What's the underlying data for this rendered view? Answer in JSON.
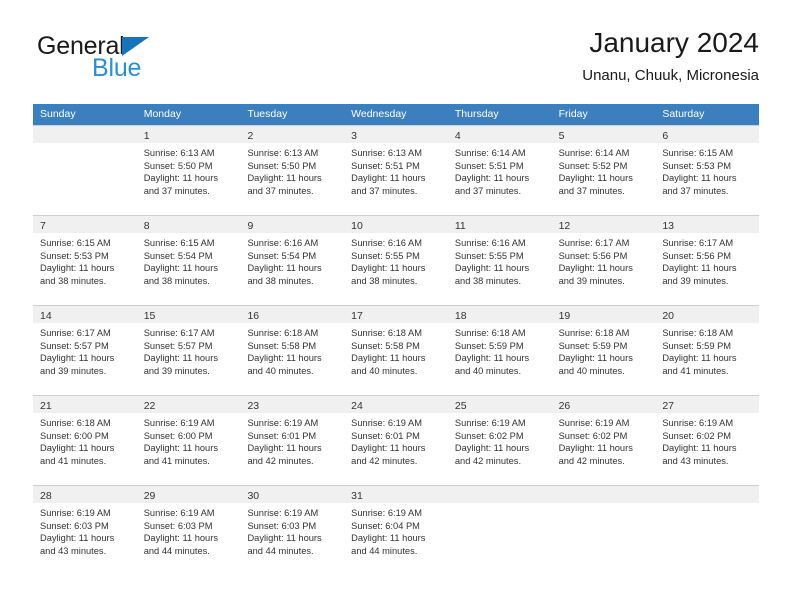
{
  "brand": {
    "name_part1": "General",
    "name_part2": "Blue",
    "triangle_color": "#1773ba",
    "blue_color": "#2b8fd4"
  },
  "header": {
    "title": "January 2024",
    "subtitle": "Unanu, Chuuk, Micronesia"
  },
  "theme": {
    "header_row_bg": "#3b7fbf",
    "header_row_text": "#ffffff",
    "daynum_band_bg": "#f0f0f0",
    "grid_line": "#cfcfcf",
    "body_text": "#333333"
  },
  "weekdays": [
    "Sunday",
    "Monday",
    "Tuesday",
    "Wednesday",
    "Thursday",
    "Friday",
    "Saturday"
  ],
  "weeks": [
    [
      {
        "day": "",
        "sunrise": "",
        "sunset": "",
        "daylight_line1": "",
        "daylight_line2": "",
        "empty": true
      },
      {
        "day": "1",
        "sunrise": "Sunrise: 6:13 AM",
        "sunset": "Sunset: 5:50 PM",
        "daylight_line1": "Daylight: 11 hours",
        "daylight_line2": "and 37 minutes."
      },
      {
        "day": "2",
        "sunrise": "Sunrise: 6:13 AM",
        "sunset": "Sunset: 5:50 PM",
        "daylight_line1": "Daylight: 11 hours",
        "daylight_line2": "and 37 minutes."
      },
      {
        "day": "3",
        "sunrise": "Sunrise: 6:13 AM",
        "sunset": "Sunset: 5:51 PM",
        "daylight_line1": "Daylight: 11 hours",
        "daylight_line2": "and 37 minutes."
      },
      {
        "day": "4",
        "sunrise": "Sunrise: 6:14 AM",
        "sunset": "Sunset: 5:51 PM",
        "daylight_line1": "Daylight: 11 hours",
        "daylight_line2": "and 37 minutes."
      },
      {
        "day": "5",
        "sunrise": "Sunrise: 6:14 AM",
        "sunset": "Sunset: 5:52 PM",
        "daylight_line1": "Daylight: 11 hours",
        "daylight_line2": "and 37 minutes."
      },
      {
        "day": "6",
        "sunrise": "Sunrise: 6:15 AM",
        "sunset": "Sunset: 5:53 PM",
        "daylight_line1": "Daylight: 11 hours",
        "daylight_line2": "and 37 minutes."
      }
    ],
    [
      {
        "day": "7",
        "sunrise": "Sunrise: 6:15 AM",
        "sunset": "Sunset: 5:53 PM",
        "daylight_line1": "Daylight: 11 hours",
        "daylight_line2": "and 38 minutes."
      },
      {
        "day": "8",
        "sunrise": "Sunrise: 6:15 AM",
        "sunset": "Sunset: 5:54 PM",
        "daylight_line1": "Daylight: 11 hours",
        "daylight_line2": "and 38 minutes."
      },
      {
        "day": "9",
        "sunrise": "Sunrise: 6:16 AM",
        "sunset": "Sunset: 5:54 PM",
        "daylight_line1": "Daylight: 11 hours",
        "daylight_line2": "and 38 minutes."
      },
      {
        "day": "10",
        "sunrise": "Sunrise: 6:16 AM",
        "sunset": "Sunset: 5:55 PM",
        "daylight_line1": "Daylight: 11 hours",
        "daylight_line2": "and 38 minutes."
      },
      {
        "day": "11",
        "sunrise": "Sunrise: 6:16 AM",
        "sunset": "Sunset: 5:55 PM",
        "daylight_line1": "Daylight: 11 hours",
        "daylight_line2": "and 38 minutes."
      },
      {
        "day": "12",
        "sunrise": "Sunrise: 6:17 AM",
        "sunset": "Sunset: 5:56 PM",
        "daylight_line1": "Daylight: 11 hours",
        "daylight_line2": "and 39 minutes."
      },
      {
        "day": "13",
        "sunrise": "Sunrise: 6:17 AM",
        "sunset": "Sunset: 5:56 PM",
        "daylight_line1": "Daylight: 11 hours",
        "daylight_line2": "and 39 minutes."
      }
    ],
    [
      {
        "day": "14",
        "sunrise": "Sunrise: 6:17 AM",
        "sunset": "Sunset: 5:57 PM",
        "daylight_line1": "Daylight: 11 hours",
        "daylight_line2": "and 39 minutes."
      },
      {
        "day": "15",
        "sunrise": "Sunrise: 6:17 AM",
        "sunset": "Sunset: 5:57 PM",
        "daylight_line1": "Daylight: 11 hours",
        "daylight_line2": "and 39 minutes."
      },
      {
        "day": "16",
        "sunrise": "Sunrise: 6:18 AM",
        "sunset": "Sunset: 5:58 PM",
        "daylight_line1": "Daylight: 11 hours",
        "daylight_line2": "and 40 minutes."
      },
      {
        "day": "17",
        "sunrise": "Sunrise: 6:18 AM",
        "sunset": "Sunset: 5:58 PM",
        "daylight_line1": "Daylight: 11 hours",
        "daylight_line2": "and 40 minutes."
      },
      {
        "day": "18",
        "sunrise": "Sunrise: 6:18 AM",
        "sunset": "Sunset: 5:59 PM",
        "daylight_line1": "Daylight: 11 hours",
        "daylight_line2": "and 40 minutes."
      },
      {
        "day": "19",
        "sunrise": "Sunrise: 6:18 AM",
        "sunset": "Sunset: 5:59 PM",
        "daylight_line1": "Daylight: 11 hours",
        "daylight_line2": "and 40 minutes."
      },
      {
        "day": "20",
        "sunrise": "Sunrise: 6:18 AM",
        "sunset": "Sunset: 5:59 PM",
        "daylight_line1": "Daylight: 11 hours",
        "daylight_line2": "and 41 minutes."
      }
    ],
    [
      {
        "day": "21",
        "sunrise": "Sunrise: 6:18 AM",
        "sunset": "Sunset: 6:00 PM",
        "daylight_line1": "Daylight: 11 hours",
        "daylight_line2": "and 41 minutes."
      },
      {
        "day": "22",
        "sunrise": "Sunrise: 6:19 AM",
        "sunset": "Sunset: 6:00 PM",
        "daylight_line1": "Daylight: 11 hours",
        "daylight_line2": "and 41 minutes."
      },
      {
        "day": "23",
        "sunrise": "Sunrise: 6:19 AM",
        "sunset": "Sunset: 6:01 PM",
        "daylight_line1": "Daylight: 11 hours",
        "daylight_line2": "and 42 minutes."
      },
      {
        "day": "24",
        "sunrise": "Sunrise: 6:19 AM",
        "sunset": "Sunset: 6:01 PM",
        "daylight_line1": "Daylight: 11 hours",
        "daylight_line2": "and 42 minutes."
      },
      {
        "day": "25",
        "sunrise": "Sunrise: 6:19 AM",
        "sunset": "Sunset: 6:02 PM",
        "daylight_line1": "Daylight: 11 hours",
        "daylight_line2": "and 42 minutes."
      },
      {
        "day": "26",
        "sunrise": "Sunrise: 6:19 AM",
        "sunset": "Sunset: 6:02 PM",
        "daylight_line1": "Daylight: 11 hours",
        "daylight_line2": "and 42 minutes."
      },
      {
        "day": "27",
        "sunrise": "Sunrise: 6:19 AM",
        "sunset": "Sunset: 6:02 PM",
        "daylight_line1": "Daylight: 11 hours",
        "daylight_line2": "and 43 minutes."
      }
    ],
    [
      {
        "day": "28",
        "sunrise": "Sunrise: 6:19 AM",
        "sunset": "Sunset: 6:03 PM",
        "daylight_line1": "Daylight: 11 hours",
        "daylight_line2": "and 43 minutes."
      },
      {
        "day": "29",
        "sunrise": "Sunrise: 6:19 AM",
        "sunset": "Sunset: 6:03 PM",
        "daylight_line1": "Daylight: 11 hours",
        "daylight_line2": "and 44 minutes."
      },
      {
        "day": "30",
        "sunrise": "Sunrise: 6:19 AM",
        "sunset": "Sunset: 6:03 PM",
        "daylight_line1": "Daylight: 11 hours",
        "daylight_line2": "and 44 minutes."
      },
      {
        "day": "31",
        "sunrise": "Sunrise: 6:19 AM",
        "sunset": "Sunset: 6:04 PM",
        "daylight_line1": "Daylight: 11 hours",
        "daylight_line2": "and 44 minutes."
      },
      {
        "day": "",
        "sunrise": "",
        "sunset": "",
        "daylight_line1": "",
        "daylight_line2": "",
        "empty": true
      },
      {
        "day": "",
        "sunrise": "",
        "sunset": "",
        "daylight_line1": "",
        "daylight_line2": "",
        "empty": true
      },
      {
        "day": "",
        "sunrise": "",
        "sunset": "",
        "daylight_line1": "",
        "daylight_line2": "",
        "empty": true
      }
    ]
  ]
}
